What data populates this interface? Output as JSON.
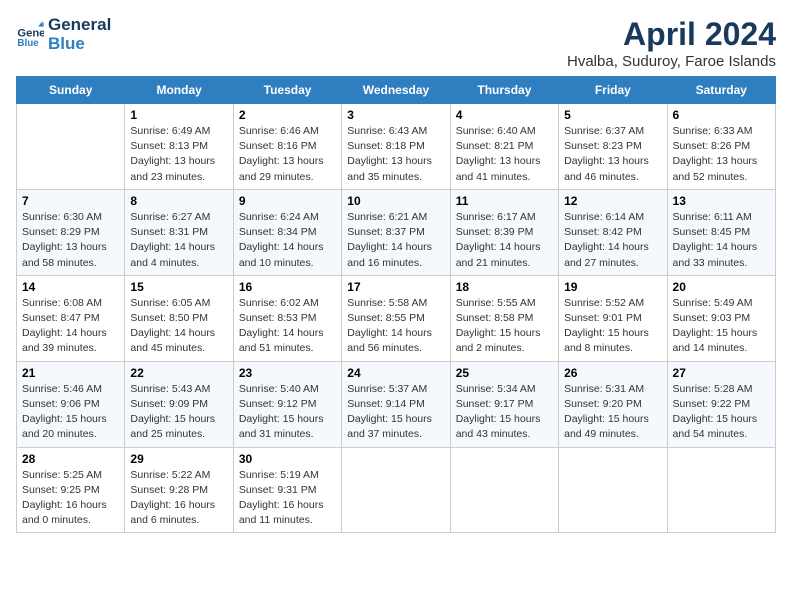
{
  "header": {
    "logo_line1": "General",
    "logo_line2": "Blue",
    "month_title": "April 2024",
    "subtitle": "Hvalba, Suduroy, Faroe Islands"
  },
  "weekdays": [
    "Sunday",
    "Monday",
    "Tuesday",
    "Wednesday",
    "Thursday",
    "Friday",
    "Saturday"
  ],
  "weeks": [
    [
      {
        "day": "",
        "info": ""
      },
      {
        "day": "1",
        "info": "Sunrise: 6:49 AM\nSunset: 8:13 PM\nDaylight: 13 hours\nand 23 minutes."
      },
      {
        "day": "2",
        "info": "Sunrise: 6:46 AM\nSunset: 8:16 PM\nDaylight: 13 hours\nand 29 minutes."
      },
      {
        "day": "3",
        "info": "Sunrise: 6:43 AM\nSunset: 8:18 PM\nDaylight: 13 hours\nand 35 minutes."
      },
      {
        "day": "4",
        "info": "Sunrise: 6:40 AM\nSunset: 8:21 PM\nDaylight: 13 hours\nand 41 minutes."
      },
      {
        "day": "5",
        "info": "Sunrise: 6:37 AM\nSunset: 8:23 PM\nDaylight: 13 hours\nand 46 minutes."
      },
      {
        "day": "6",
        "info": "Sunrise: 6:33 AM\nSunset: 8:26 PM\nDaylight: 13 hours\nand 52 minutes."
      }
    ],
    [
      {
        "day": "7",
        "info": "Sunrise: 6:30 AM\nSunset: 8:29 PM\nDaylight: 13 hours\nand 58 minutes."
      },
      {
        "day": "8",
        "info": "Sunrise: 6:27 AM\nSunset: 8:31 PM\nDaylight: 14 hours\nand 4 minutes."
      },
      {
        "day": "9",
        "info": "Sunrise: 6:24 AM\nSunset: 8:34 PM\nDaylight: 14 hours\nand 10 minutes."
      },
      {
        "day": "10",
        "info": "Sunrise: 6:21 AM\nSunset: 8:37 PM\nDaylight: 14 hours\nand 16 minutes."
      },
      {
        "day": "11",
        "info": "Sunrise: 6:17 AM\nSunset: 8:39 PM\nDaylight: 14 hours\nand 21 minutes."
      },
      {
        "day": "12",
        "info": "Sunrise: 6:14 AM\nSunset: 8:42 PM\nDaylight: 14 hours\nand 27 minutes."
      },
      {
        "day": "13",
        "info": "Sunrise: 6:11 AM\nSunset: 8:45 PM\nDaylight: 14 hours\nand 33 minutes."
      }
    ],
    [
      {
        "day": "14",
        "info": "Sunrise: 6:08 AM\nSunset: 8:47 PM\nDaylight: 14 hours\nand 39 minutes."
      },
      {
        "day": "15",
        "info": "Sunrise: 6:05 AM\nSunset: 8:50 PM\nDaylight: 14 hours\nand 45 minutes."
      },
      {
        "day": "16",
        "info": "Sunrise: 6:02 AM\nSunset: 8:53 PM\nDaylight: 14 hours\nand 51 minutes."
      },
      {
        "day": "17",
        "info": "Sunrise: 5:58 AM\nSunset: 8:55 PM\nDaylight: 14 hours\nand 56 minutes."
      },
      {
        "day": "18",
        "info": "Sunrise: 5:55 AM\nSunset: 8:58 PM\nDaylight: 15 hours\nand 2 minutes."
      },
      {
        "day": "19",
        "info": "Sunrise: 5:52 AM\nSunset: 9:01 PM\nDaylight: 15 hours\nand 8 minutes."
      },
      {
        "day": "20",
        "info": "Sunrise: 5:49 AM\nSunset: 9:03 PM\nDaylight: 15 hours\nand 14 minutes."
      }
    ],
    [
      {
        "day": "21",
        "info": "Sunrise: 5:46 AM\nSunset: 9:06 PM\nDaylight: 15 hours\nand 20 minutes."
      },
      {
        "day": "22",
        "info": "Sunrise: 5:43 AM\nSunset: 9:09 PM\nDaylight: 15 hours\nand 25 minutes."
      },
      {
        "day": "23",
        "info": "Sunrise: 5:40 AM\nSunset: 9:12 PM\nDaylight: 15 hours\nand 31 minutes."
      },
      {
        "day": "24",
        "info": "Sunrise: 5:37 AM\nSunset: 9:14 PM\nDaylight: 15 hours\nand 37 minutes."
      },
      {
        "day": "25",
        "info": "Sunrise: 5:34 AM\nSunset: 9:17 PM\nDaylight: 15 hours\nand 43 minutes."
      },
      {
        "day": "26",
        "info": "Sunrise: 5:31 AM\nSunset: 9:20 PM\nDaylight: 15 hours\nand 49 minutes."
      },
      {
        "day": "27",
        "info": "Sunrise: 5:28 AM\nSunset: 9:22 PM\nDaylight: 15 hours\nand 54 minutes."
      }
    ],
    [
      {
        "day": "28",
        "info": "Sunrise: 5:25 AM\nSunset: 9:25 PM\nDaylight: 16 hours\nand 0 minutes."
      },
      {
        "day": "29",
        "info": "Sunrise: 5:22 AM\nSunset: 9:28 PM\nDaylight: 16 hours\nand 6 minutes."
      },
      {
        "day": "30",
        "info": "Sunrise: 5:19 AM\nSunset: 9:31 PM\nDaylight: 16 hours\nand 11 minutes."
      },
      {
        "day": "",
        "info": ""
      },
      {
        "day": "",
        "info": ""
      },
      {
        "day": "",
        "info": ""
      },
      {
        "day": "",
        "info": ""
      }
    ]
  ]
}
